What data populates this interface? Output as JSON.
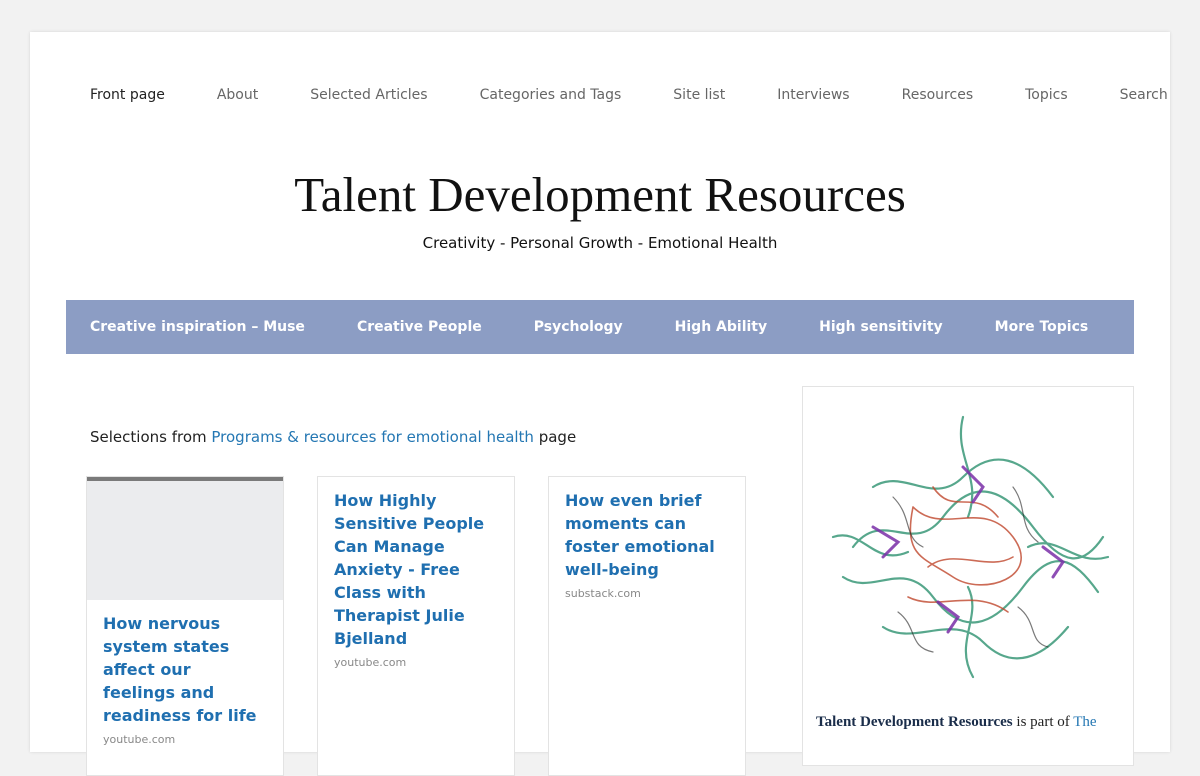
{
  "topnav": {
    "items": [
      "Front page",
      "About",
      "Selected Articles",
      "Categories and Tags",
      "Site list",
      "Interviews",
      "Resources",
      "Topics",
      "Search"
    ]
  },
  "header": {
    "title": "Talent Development Resources",
    "tagline": "Creativity - Personal Growth - Emotional Health"
  },
  "category_nav": {
    "items": [
      "Creative inspiration – Muse",
      "Creative People",
      "Psychology",
      "High Ability",
      "High sensitivity",
      "More Topics"
    ]
  },
  "main": {
    "intro_prefix": "Selections from ",
    "intro_link": "Programs & resources for emotional health",
    "intro_suffix": " page",
    "cards": [
      {
        "title": "How nervous system states affect our feelings and readiness for life",
        "source": "youtube.com"
      },
      {
        "title": "How Highly Sensitive People Can Manage Anxiety - Free Class with Therapist Julie Bjelland",
        "source": "youtube.com"
      },
      {
        "title": "How even brief moments can foster emotional well-being",
        "source": "substack.com"
      }
    ]
  },
  "sidebar": {
    "about_bold": "Talent Development Resources",
    "about_text": " is part of ",
    "about_link": "The"
  },
  "colors": {
    "accent_link": "#2477b3",
    "category_bar": "#8c9dc4"
  }
}
